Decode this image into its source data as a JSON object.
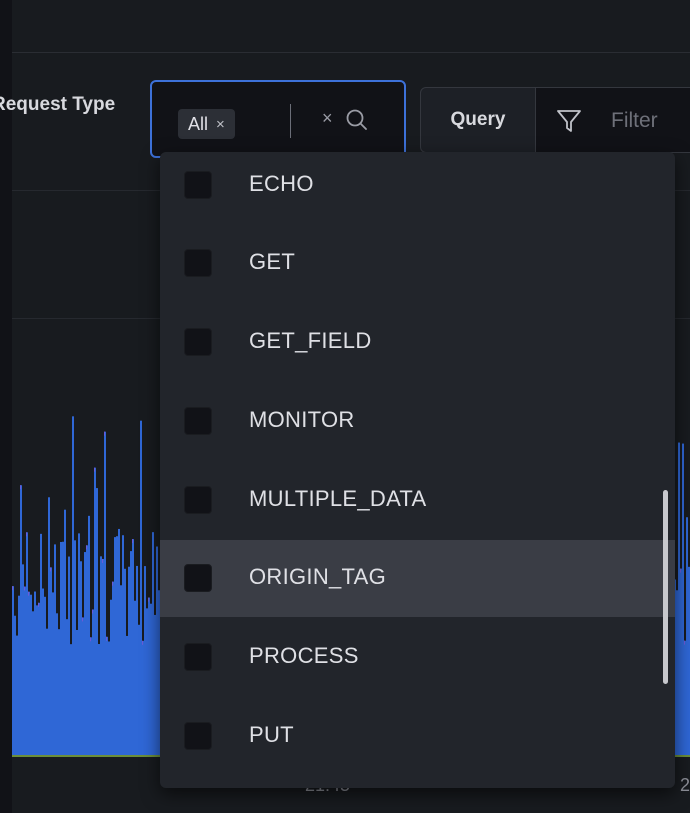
{
  "filter_bar": {
    "request_type_label": "Request Type",
    "selected_chip": "All",
    "chip_remove": "×",
    "clear_all": "×",
    "query_label": "Query",
    "filter_placeholder": "Filter"
  },
  "dropdown": {
    "options": [
      "ECHO",
      "GET",
      "GET_FIELD",
      "MONITOR",
      "MULTIPLE_DATA",
      "ORIGIN_TAG",
      "PROCESS",
      "PUT"
    ],
    "hovered_option": "ORIGIN_TAG",
    "checked": [
      false,
      false,
      false,
      false,
      false,
      false,
      false,
      false
    ]
  },
  "chart": {
    "x_tick_partial_1": "21:45",
    "x_tick_partial_2": "2"
  },
  "colors": {
    "accent": "#3d71d9",
    "bar_fill": "#2f67d6",
    "bar_edge": "#6c5ad8"
  }
}
